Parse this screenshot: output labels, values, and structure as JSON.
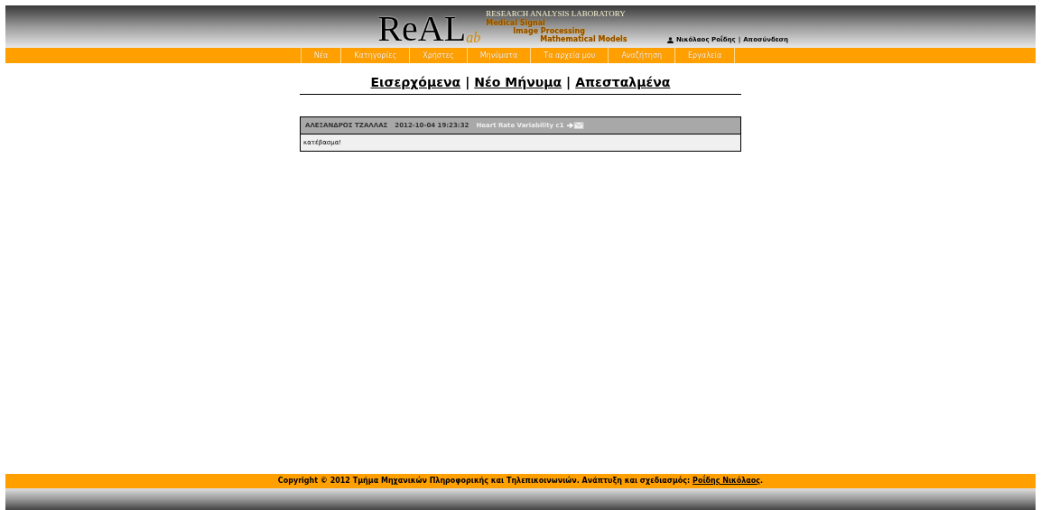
{
  "header": {
    "logo": {
      "main": "ReAL",
      "suffix": "ab",
      "tagline": "RESEARCH ANALYSIS LABORATORY",
      "lines": [
        "Medical Signal",
        "Image Processing",
        "Mathematical Models"
      ]
    },
    "user": {
      "name": "Νικόλαος Ροΐδης",
      "separator": "|",
      "logout": "Αποσύνδεση"
    }
  },
  "nav": [
    {
      "label": "Νέα"
    },
    {
      "label": "Κατηγορίες"
    },
    {
      "label": "Χρήστες"
    },
    {
      "label": "Μηνύματα"
    },
    {
      "label": "Τα αρχεία μου"
    },
    {
      "label": "Αναζήτηση"
    },
    {
      "label": "Εργαλεία"
    }
  ],
  "mail_tabs": [
    "Εισερχόμενα",
    "Νέο Μήνυμα",
    "Απεσταλμένα"
  ],
  "mail_tab_separators": [
    "|",
    "|"
  ],
  "messages": [
    {
      "sender": "ΑΛΕΞΑΝΔΡΟΣ ΤΖΑΛΛΑΣ",
      "date": "2012-10-04 19:23:32",
      "subject": "Heart Rate Variability c1",
      "body": "κατέβασμα!"
    }
  ],
  "footer": {
    "text": "Copyright © 2012 Τμήμα Μηχανικών Πληροφορικής και Τηλεπικοινωνιών. Ανάπτυξη και σχεδιασμός:",
    "link": "Ροΐδης Νικόλαος",
    "end": "."
  }
}
